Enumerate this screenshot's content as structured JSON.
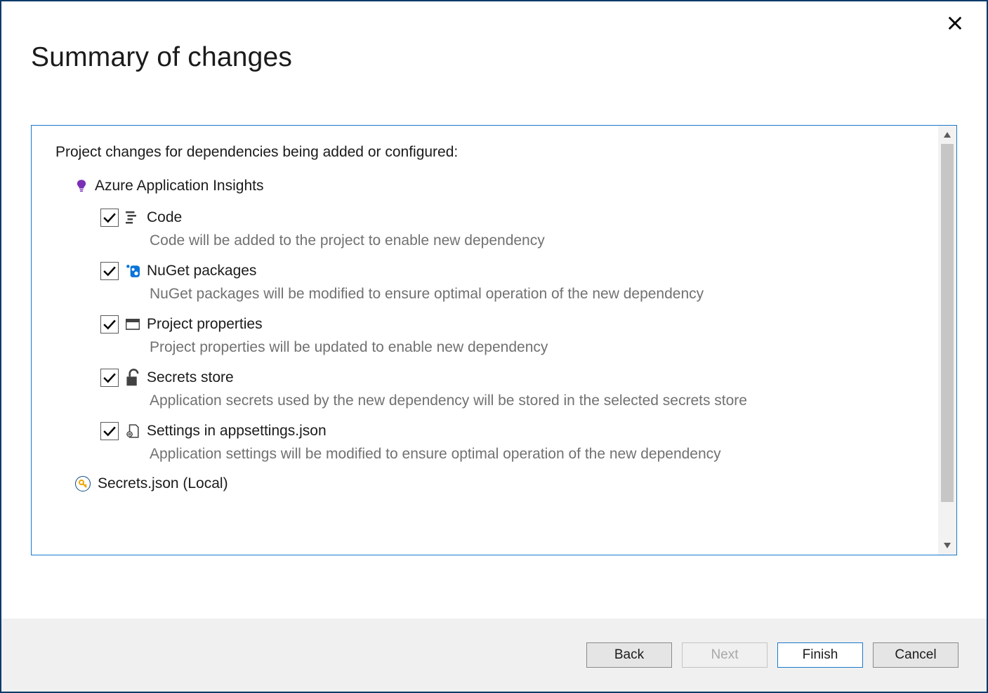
{
  "title": "Summary of changes",
  "intro": "Project changes for dependencies being added or configured:",
  "dependency_label": "Azure Application Insights",
  "items": [
    {
      "title": "Code",
      "desc": "Code will be added to the project to enable new dependency",
      "checked": true
    },
    {
      "title": "NuGet packages",
      "desc": "NuGet packages will be modified to ensure optimal operation of the new dependency",
      "checked": true
    },
    {
      "title": "Project properties",
      "desc": "Project properties will be updated to enable new dependency",
      "checked": true
    },
    {
      "title": "Secrets store",
      "desc": "Application secrets used by the new dependency will be stored in the selected secrets store",
      "checked": true
    },
    {
      "title": "Settings in appsettings.json",
      "desc": "Application settings will be modified to ensure optimal operation of the new dependency",
      "checked": true
    }
  ],
  "secrets_row_label": "Secrets.json (Local)",
  "buttons": {
    "back": "Back",
    "next": "Next",
    "finish": "Finish",
    "cancel": "Cancel"
  }
}
